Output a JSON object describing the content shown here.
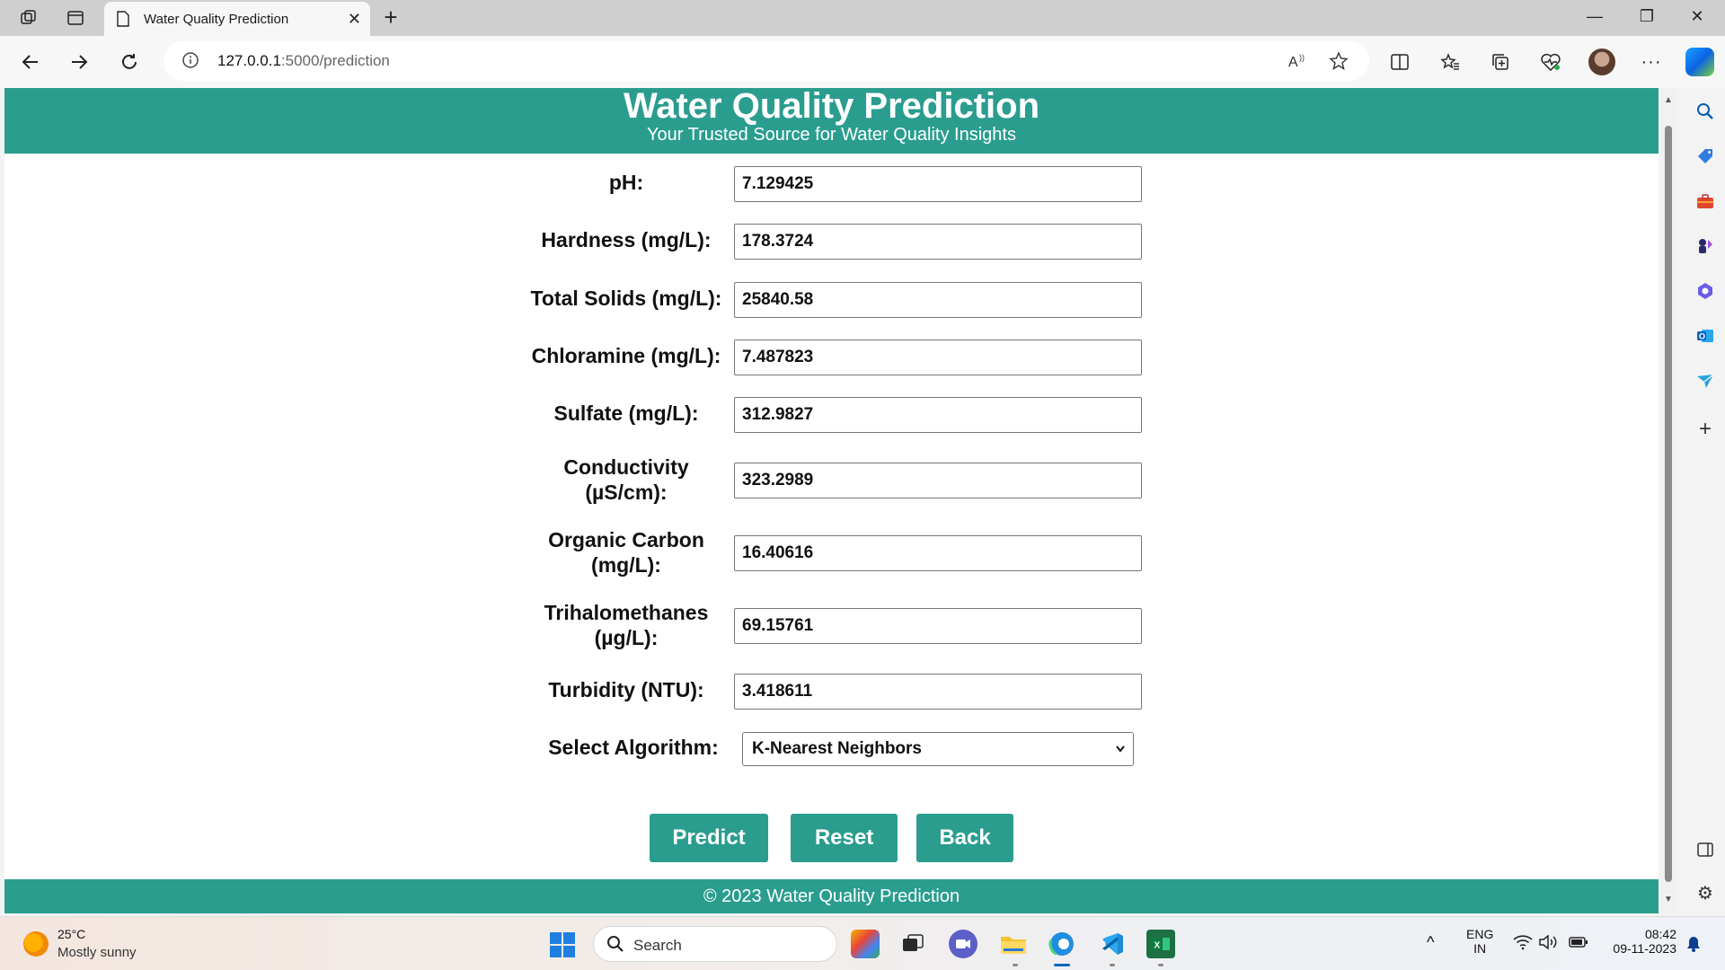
{
  "browser": {
    "tab_title": "Water Quality Prediction",
    "url_host": "127.0.0.1",
    "url_path": ":5000/prediction"
  },
  "header": {
    "title": "Water Quality Prediction",
    "subtitle": "Your Trusted Source for Water Quality Insights"
  },
  "form": {
    "fields": [
      {
        "label": "pH:",
        "value": "7.129425"
      },
      {
        "label": "Hardness (mg/L):",
        "value": "178.3724"
      },
      {
        "label": "Total Solids (mg/L):",
        "value": "25840.58"
      },
      {
        "label": "Chloramine (mg/L):",
        "value": "7.487823"
      },
      {
        "label": "Sulfate (mg/L):",
        "value": "312.9827"
      },
      {
        "label_line1": "Conductivity",
        "label_line2": "(µS/cm):",
        "value": "323.2989"
      },
      {
        "label_line1": "Organic Carbon",
        "label_line2": "(mg/L):",
        "value": "16.40616"
      },
      {
        "label_line1": "Trihalomethanes",
        "label_line2": "(µg/L):",
        "value": "69.15761"
      },
      {
        "label": "Turbidity (NTU):",
        "value": "3.418611"
      }
    ],
    "algorithm_label": "Select Algorithm:",
    "algorithm_selected": "K-Nearest Neighbors"
  },
  "buttons": {
    "predict": "Predict",
    "reset": "Reset",
    "back": "Back"
  },
  "footer": {
    "text": "© 2023 Water Quality Prediction"
  },
  "taskbar": {
    "weather_temp": "25°C",
    "weather_desc": "Mostly sunny",
    "search_placeholder": "Search",
    "lang_line1": "ENG",
    "lang_line2": "IN",
    "time": "08:42",
    "date": "09-11-2023"
  },
  "colors": {
    "accent": "#2a9d8f"
  }
}
